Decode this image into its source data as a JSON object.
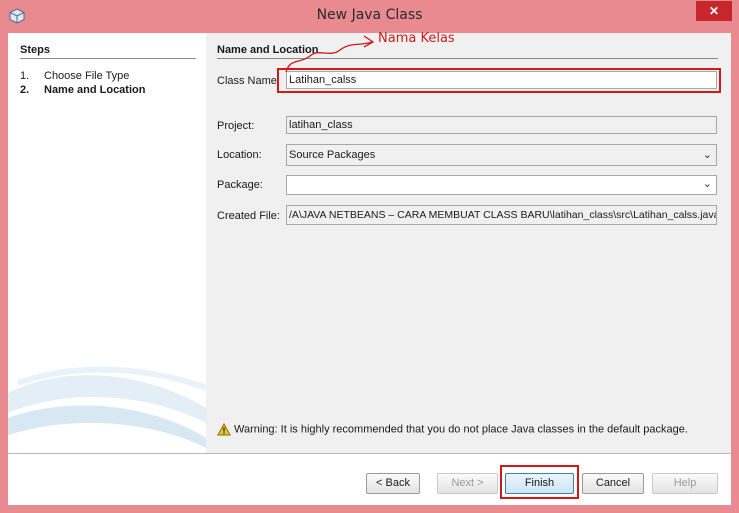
{
  "window": {
    "title": "New Java Class",
    "close_glyph": "✕"
  },
  "steps": {
    "title": "Steps",
    "items": [
      {
        "num": "1.",
        "label": "Choose File Type"
      },
      {
        "num": "2.",
        "label": "Name and Location"
      }
    ]
  },
  "form": {
    "section_title": "Name and Location",
    "class_name_label": "Class Name:",
    "class_name_value": "Latihan_calss",
    "project_label": "Project:",
    "project_value": "latihan_class",
    "location_label": "Location:",
    "location_value": "Source Packages",
    "package_label": "Package:",
    "package_value": "",
    "created_file_label": "Created File:",
    "created_file_value": "/A\\JAVA NETBEANS – CARA MEMBUAT CLASS BARU\\latihan_class\\src\\Latihan_calss.java",
    "warning": "Warning: It is highly recommended that you do not place Java classes in the default package."
  },
  "annotation": {
    "text": "Nama Kelas",
    "color": "#d01a1a"
  },
  "buttons": {
    "back": "< Back",
    "next": "Next >",
    "finish": "Finish",
    "cancel": "Cancel",
    "help": "Help"
  },
  "icons": {
    "app": "netbeans-cube-icon",
    "warning": "warning-triangle-icon",
    "dropdown": "chevron-down-icon"
  }
}
